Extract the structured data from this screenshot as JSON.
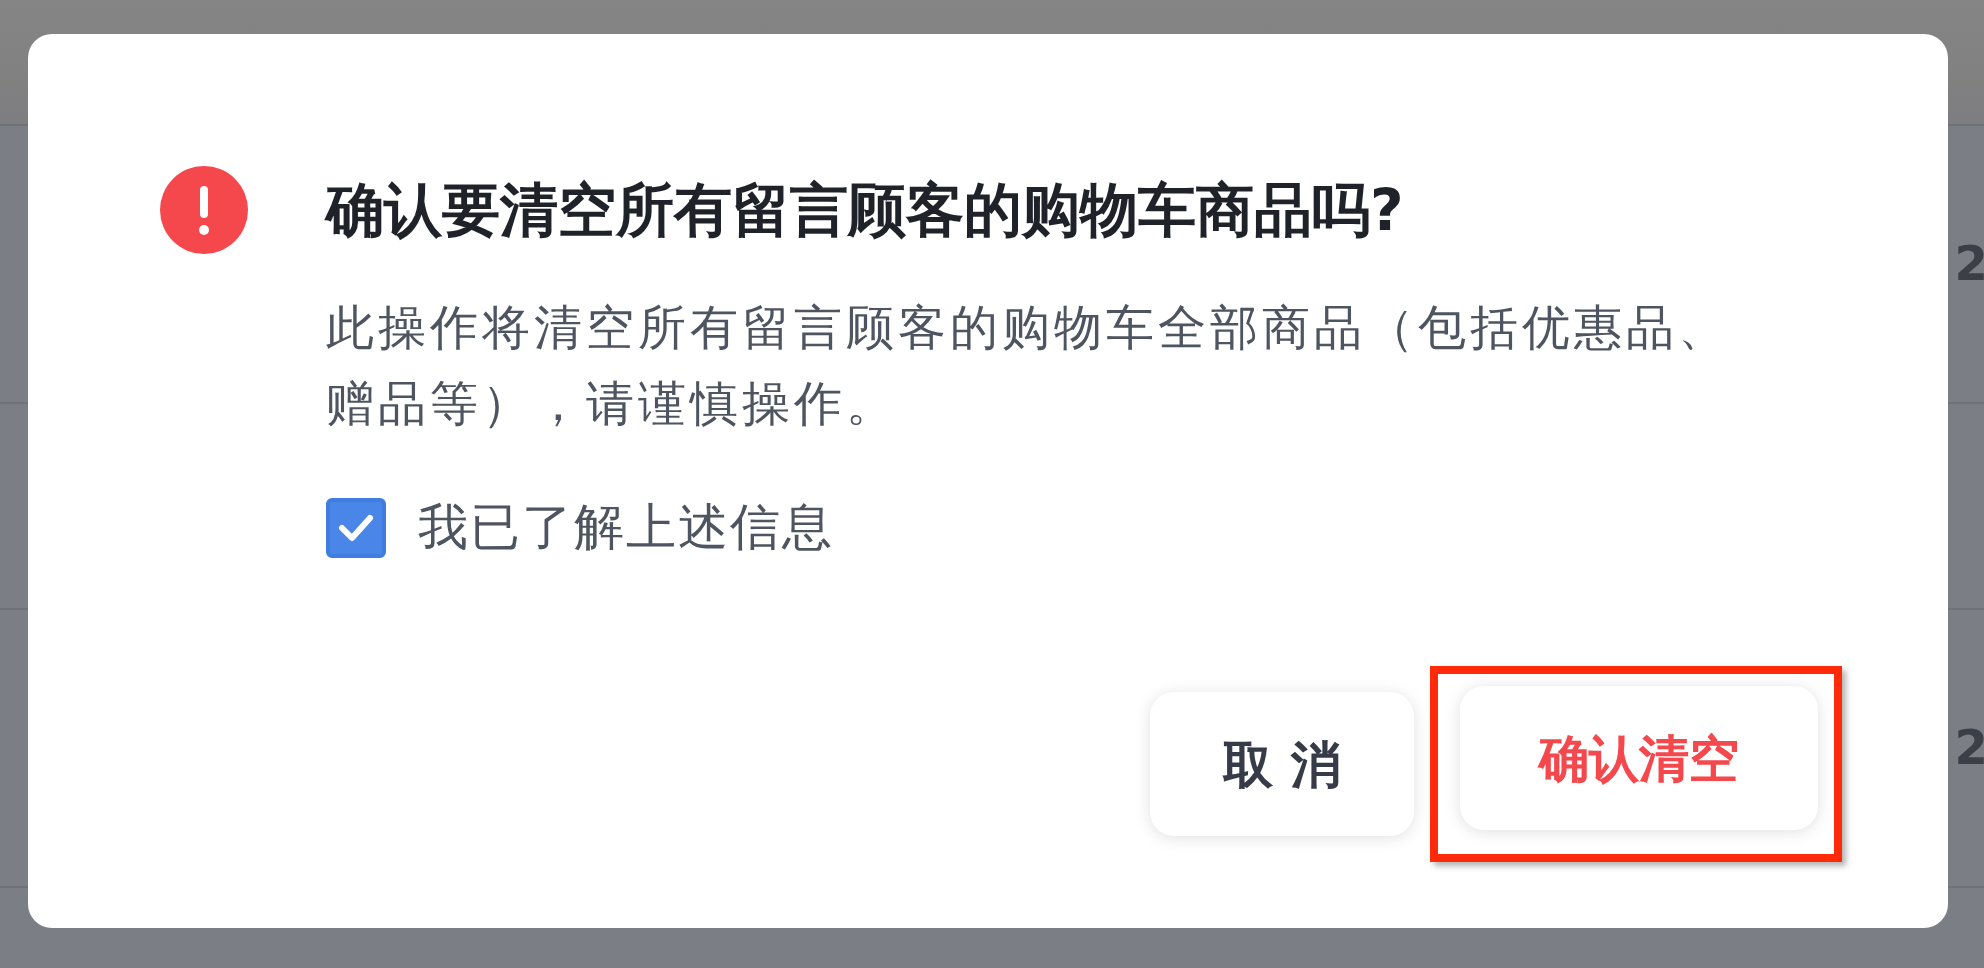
{
  "background": {
    "rows": [
      {
        "cell": "2"
      },
      {
        "cell": "2"
      }
    ]
  },
  "dialog": {
    "title": "确认要清空所有留言顾客的购物车商品吗?",
    "description": "此操作将清空所有留言顾客的购物车全部商品（包括优惠品、赠品等），请谨慎操作。",
    "checkbox": {
      "label": "我已了解上述信息",
      "checked": true
    },
    "buttons": [
      {
        "label": "取 消",
        "kind": "default",
        "highlighted": false
      },
      {
        "label": "确认清空",
        "kind": "danger",
        "highlighted": true
      }
    ]
  }
}
